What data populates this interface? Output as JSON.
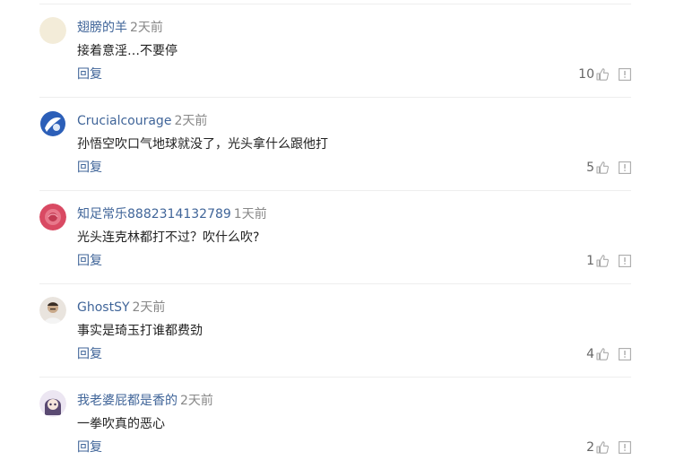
{
  "comments": [
    {
      "username": "翅膀的羊",
      "time": "2天前",
      "content": "接着意淫…不要停",
      "reply_label": "回复",
      "likes": "10",
      "avatar_color": "#f3ecd9"
    },
    {
      "username": "Crucialcourage",
      "time": "2天前",
      "content": "孙悟空吹口气地球就没了，光头拿什么跟他打",
      "reply_label": "回复",
      "likes": "5",
      "avatar_color": "#2c5fb8"
    },
    {
      "username": "知足常乐8882314132789",
      "time": "1天前",
      "content": "光头连克林都打不过？吹什么吹?",
      "reply_label": "回复",
      "likes": "1",
      "avatar_color": "#d94a63"
    },
    {
      "username": "GhostSY",
      "time": "2天前",
      "content": "事实是琦玉打谁都费劲",
      "reply_label": "回复",
      "likes": "4",
      "avatar_color": "#c9b8a6"
    },
    {
      "username": "我老婆屁都是香的",
      "time": "2天前",
      "content": "一拳吹真的恶心",
      "reply_label": "回复",
      "likes": "2",
      "avatar_color": "#5a4a72"
    }
  ],
  "icons": {
    "like": "thumbs-up-icon",
    "report": "report-icon"
  },
  "colors": {
    "username": "#406599",
    "time": "#888888",
    "content": "#222222",
    "icon": "#aaaaaa",
    "divider": "#eeeeee"
  }
}
